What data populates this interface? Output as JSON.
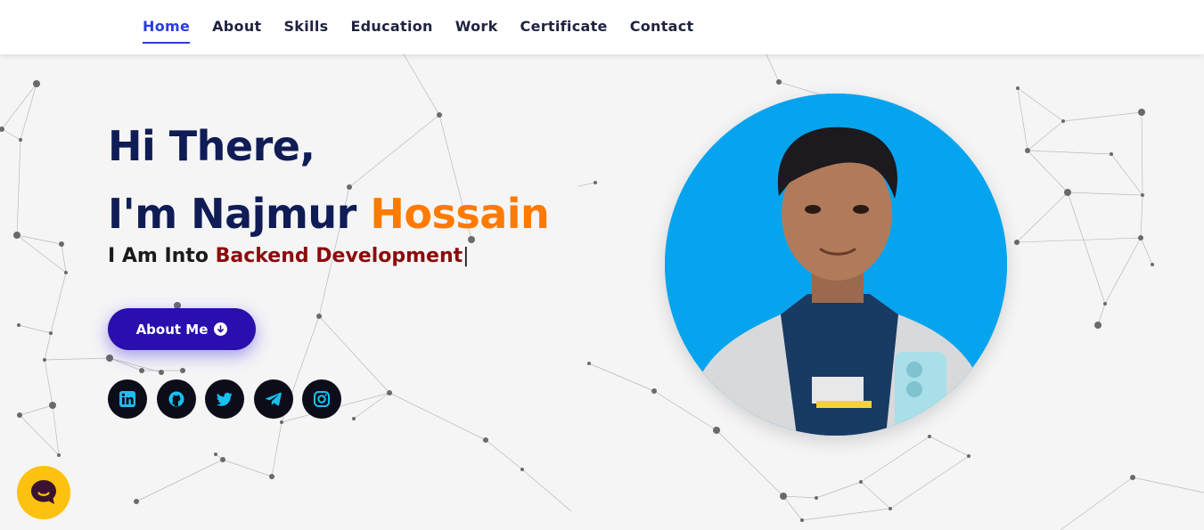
{
  "nav": {
    "items": [
      "Home",
      "About",
      "Skills",
      "Education",
      "Work",
      "Certificate",
      "Contact"
    ],
    "active": "Home"
  },
  "hero": {
    "greeting": "Hi There,",
    "intro_prefix": "I'm Najmur ",
    "intro_highlight": "Hossain",
    "tagline_prefix": "I Am Into ",
    "tagline_role": "Backend Development",
    "tagline_cursor": "|"
  },
  "buttons": {
    "about_label": "About Me"
  },
  "socials": [
    "linkedin-icon",
    "github-icon",
    "twitter-icon",
    "telegram-icon",
    "instagram-icon"
  ],
  "colors": {
    "nav_active": "#2b3de0",
    "heading": "#0f1c55",
    "highlight": "#ff7a00",
    "role": "#8c0b0b",
    "button": "#2a0fae",
    "social_bg": "#0d0d1a",
    "social_icon": "#17c1f2",
    "avatar_bg": "#06a4ef",
    "chat_bubble": "#fdc10f"
  }
}
